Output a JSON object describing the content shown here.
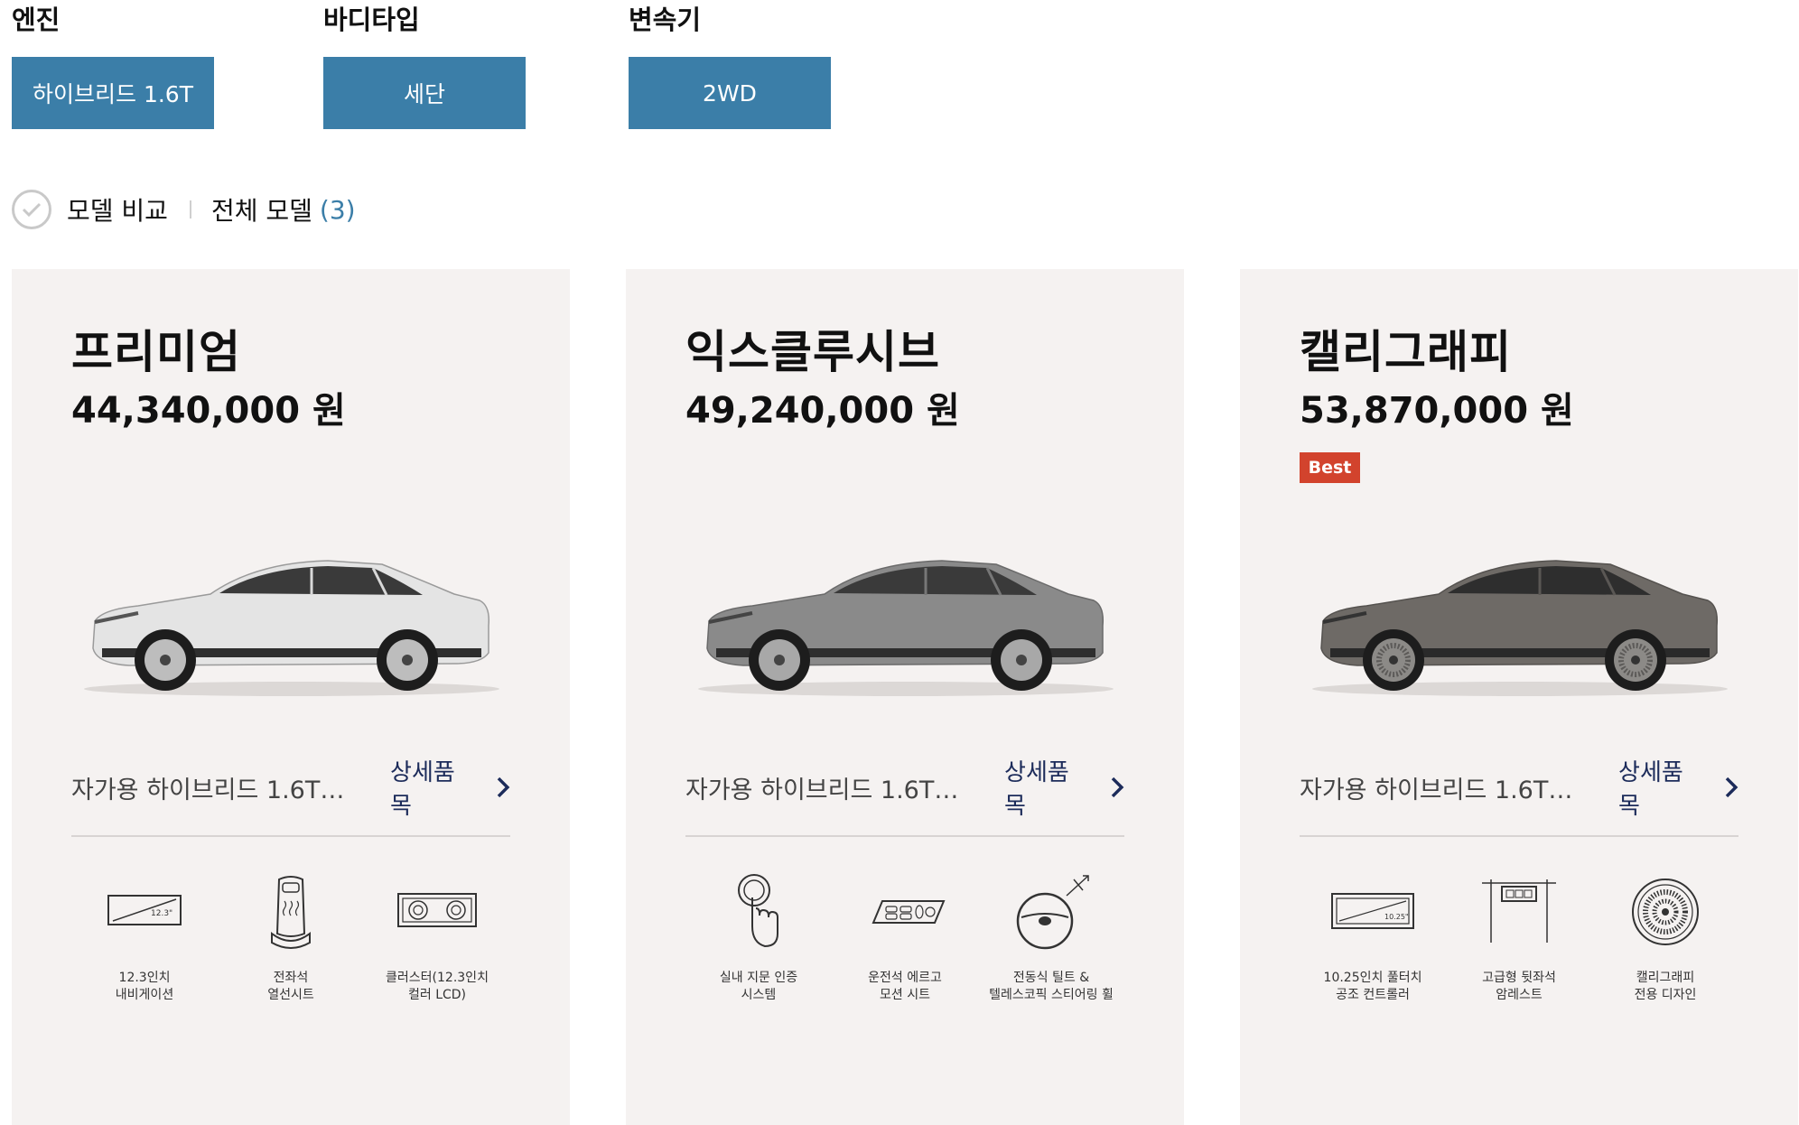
{
  "filters": [
    {
      "label": "엔진",
      "value": "하이브리드 1.6T"
    },
    {
      "label": "바디타입",
      "value": "세단"
    },
    {
      "label": "변속기",
      "value": "2WD"
    }
  ],
  "compare": {
    "label": "모델 비교",
    "all_label": "전체 모델",
    "all_count": "(3)"
  },
  "colors": {
    "filter_button": "#3b7ea8",
    "card_background": "#f5f2f1",
    "best_badge": "#d2432d",
    "detail_link": "#1c2b5a"
  },
  "cards": [
    {
      "name": "프리미엄",
      "price": "44,340,000 원",
      "badge": "",
      "car_color": "white",
      "description": "자가용 하이브리드 1.6T…",
      "detail_label": "상세품목",
      "features": [
        {
          "icon": "navigation-screen-icon",
          "screen_text": "12.3\"",
          "line1": "12.3인치",
          "line2": "내비게이션"
        },
        {
          "icon": "heated-seat-icon",
          "line1": "전좌석",
          "line2": "열선시트"
        },
        {
          "icon": "cluster-lcd-icon",
          "line1": "클러스터(12.3인치",
          "line2": "컬러 LCD)"
        }
      ]
    },
    {
      "name": "익스클루시브",
      "price": "49,240,000 원",
      "badge": "",
      "car_color": "silver",
      "description": "자가용 하이브리드 1.6T…",
      "detail_label": "상세품목",
      "features": [
        {
          "icon": "fingerprint-button-icon",
          "line1": "실내 지문 인증",
          "line2": "시스템"
        },
        {
          "icon": "ergo-seat-icon",
          "line1": "운전석 에르고",
          "line2": "모션 시트"
        },
        {
          "icon": "steering-wheel-icon",
          "line1": "전동식 틸트 &",
          "line2": "텔레스코픽 스티어링 휠"
        }
      ]
    },
    {
      "name": "캘리그래피",
      "price": "53,870,000 원",
      "badge": "Best",
      "car_color": "dark-gray",
      "description": "자가용 하이브리드 1.6T…",
      "detail_label": "상세품목",
      "features": [
        {
          "icon": "climate-control-icon",
          "screen_text": "10.25\"",
          "line1": "10.25인치 풀터치",
          "line2": "공조 컨트롤러"
        },
        {
          "icon": "rear-armrest-icon",
          "line1": "고급형 뒷좌석",
          "line2": "암레스트"
        },
        {
          "icon": "calligraphy-wheel-icon",
          "line1": "캘리그래피",
          "line2": "전용 디자인"
        }
      ]
    }
  ]
}
